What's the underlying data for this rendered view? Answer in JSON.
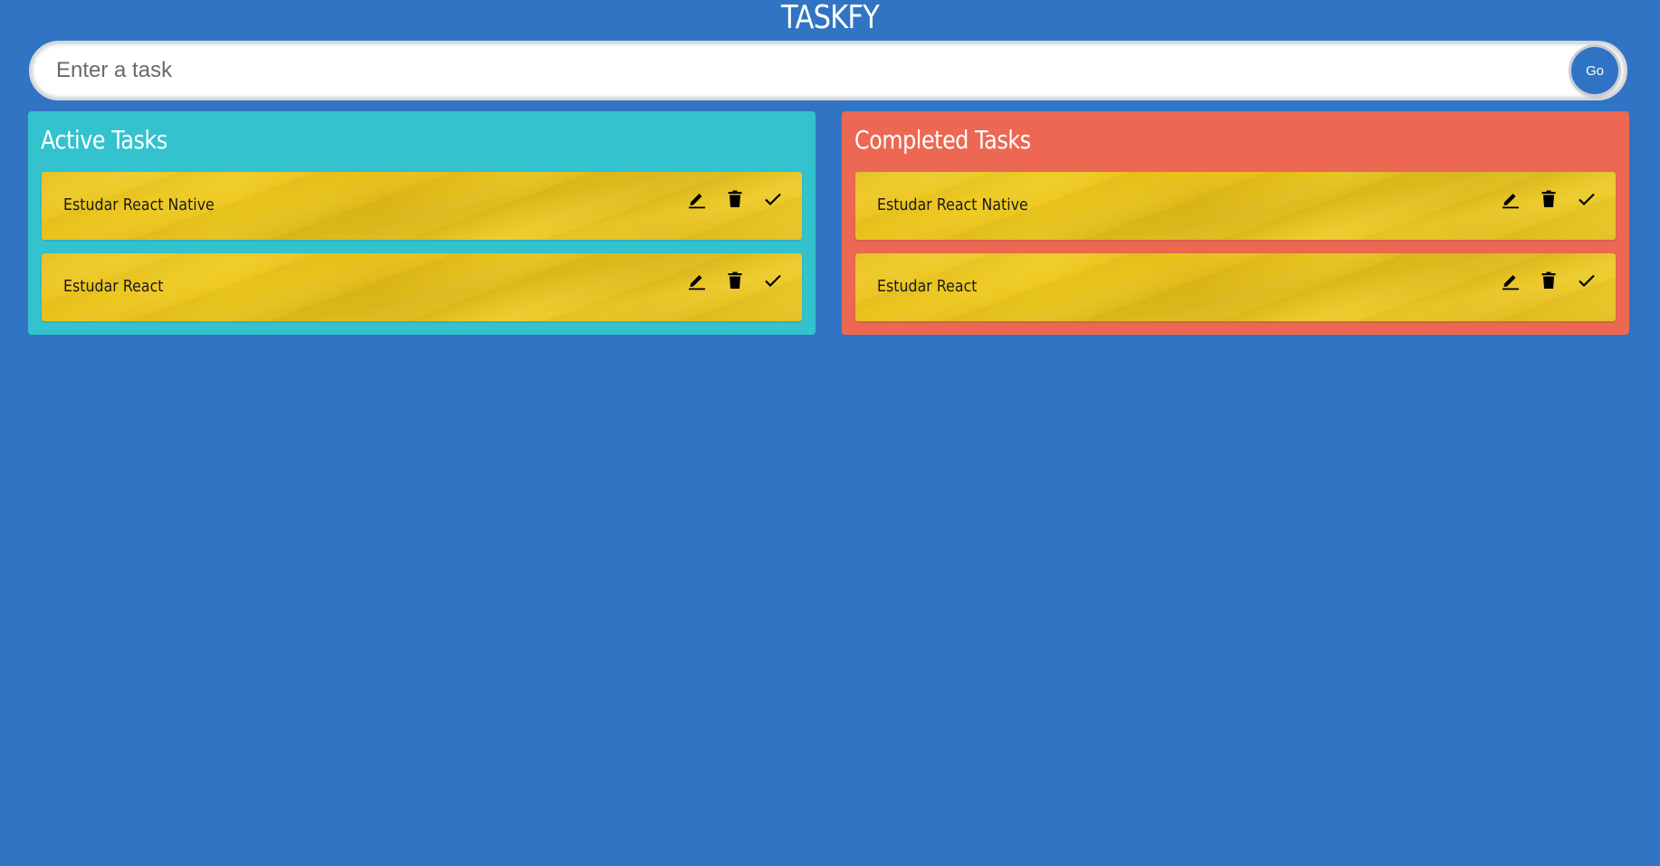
{
  "app": {
    "title": "TASKFY"
  },
  "task_form": {
    "input_value": "",
    "input_placeholder": "Enter a task",
    "submit_label": "Go"
  },
  "active_panel": {
    "title": "Active Tasks",
    "tasks": [
      {
        "text": "Estudar React Native"
      },
      {
        "text": "Estudar React"
      }
    ]
  },
  "completed_panel": {
    "title": "Completed Tasks",
    "tasks": [
      {
        "text": "Estudar React Native"
      },
      {
        "text": "Estudar React"
      }
    ]
  },
  "task_actions": {
    "icons": [
      "edit-icon",
      "delete-icon",
      "check-icon"
    ]
  },
  "colors": {
    "background": "#3074c3",
    "active_panel": "#34c2ce",
    "completed_panel": "#ec6852",
    "task_card": "#ecc51d",
    "go_button": "#2f73c4"
  }
}
